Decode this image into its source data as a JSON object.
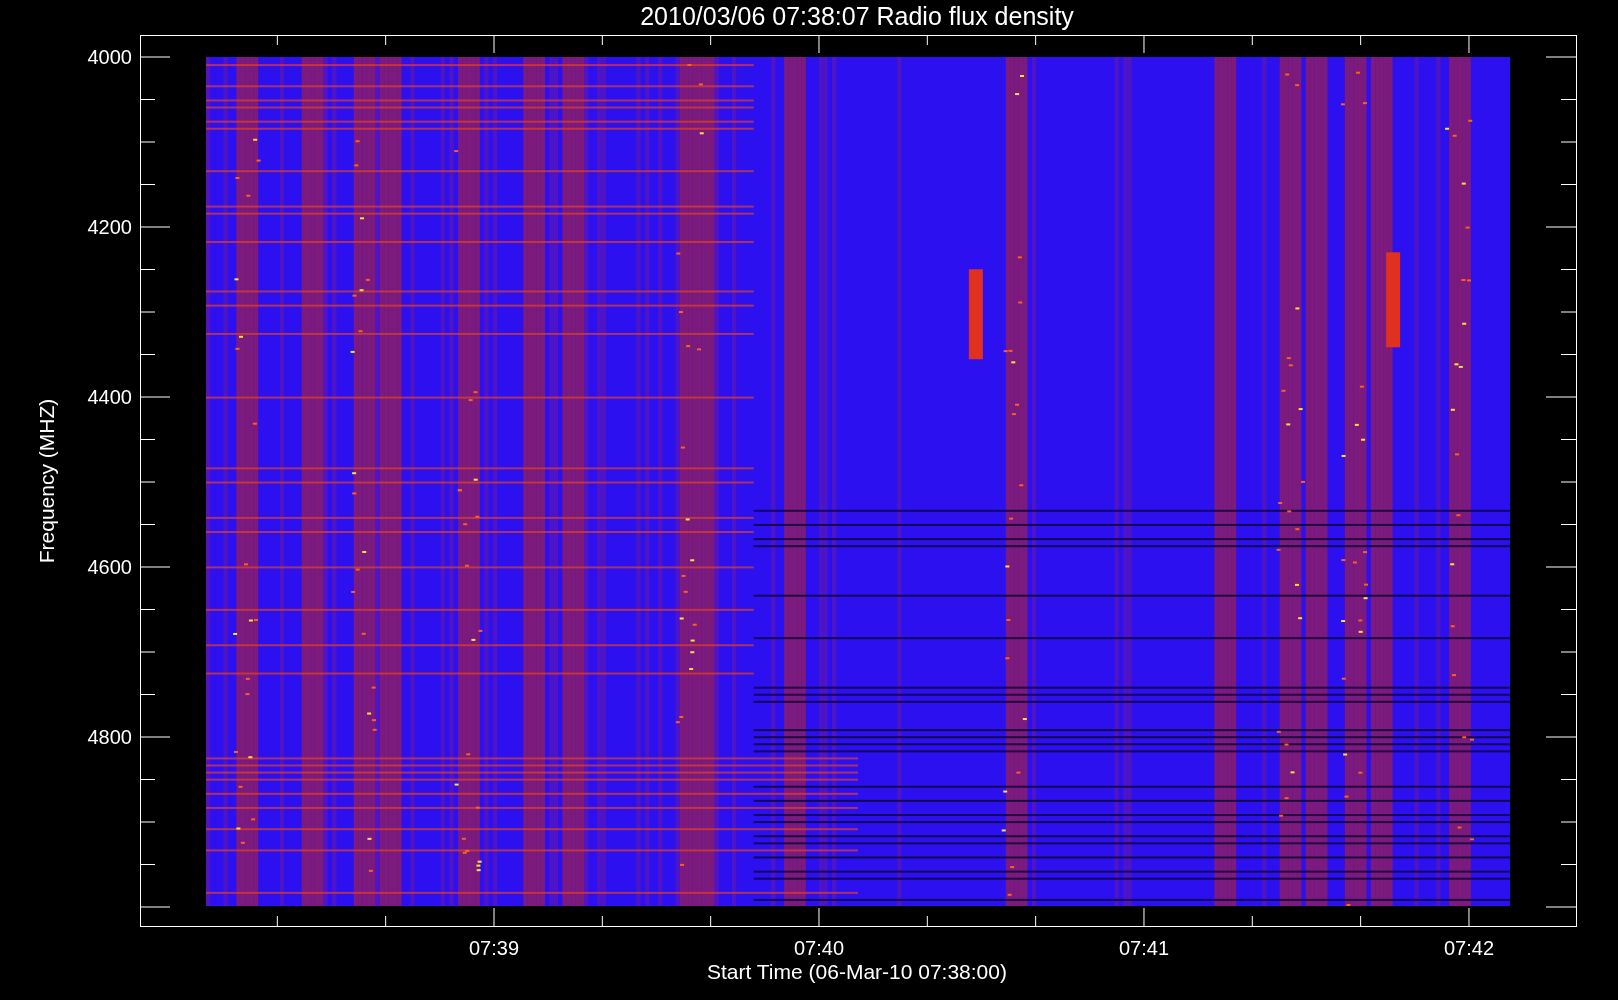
{
  "title": "2010/03/06 07:38:07 Radio flux density",
  "y_axis": {
    "label": "Frequency (MHZ)",
    "ticks": [
      "4000",
      "4200",
      "4400",
      "4600",
      "4800"
    ]
  },
  "x_axis": {
    "label": "Start Time (06-Mar-10 07:38:00)",
    "ticks": [
      "07:39",
      "07:40",
      "07:41",
      "07:42"
    ]
  }
}
